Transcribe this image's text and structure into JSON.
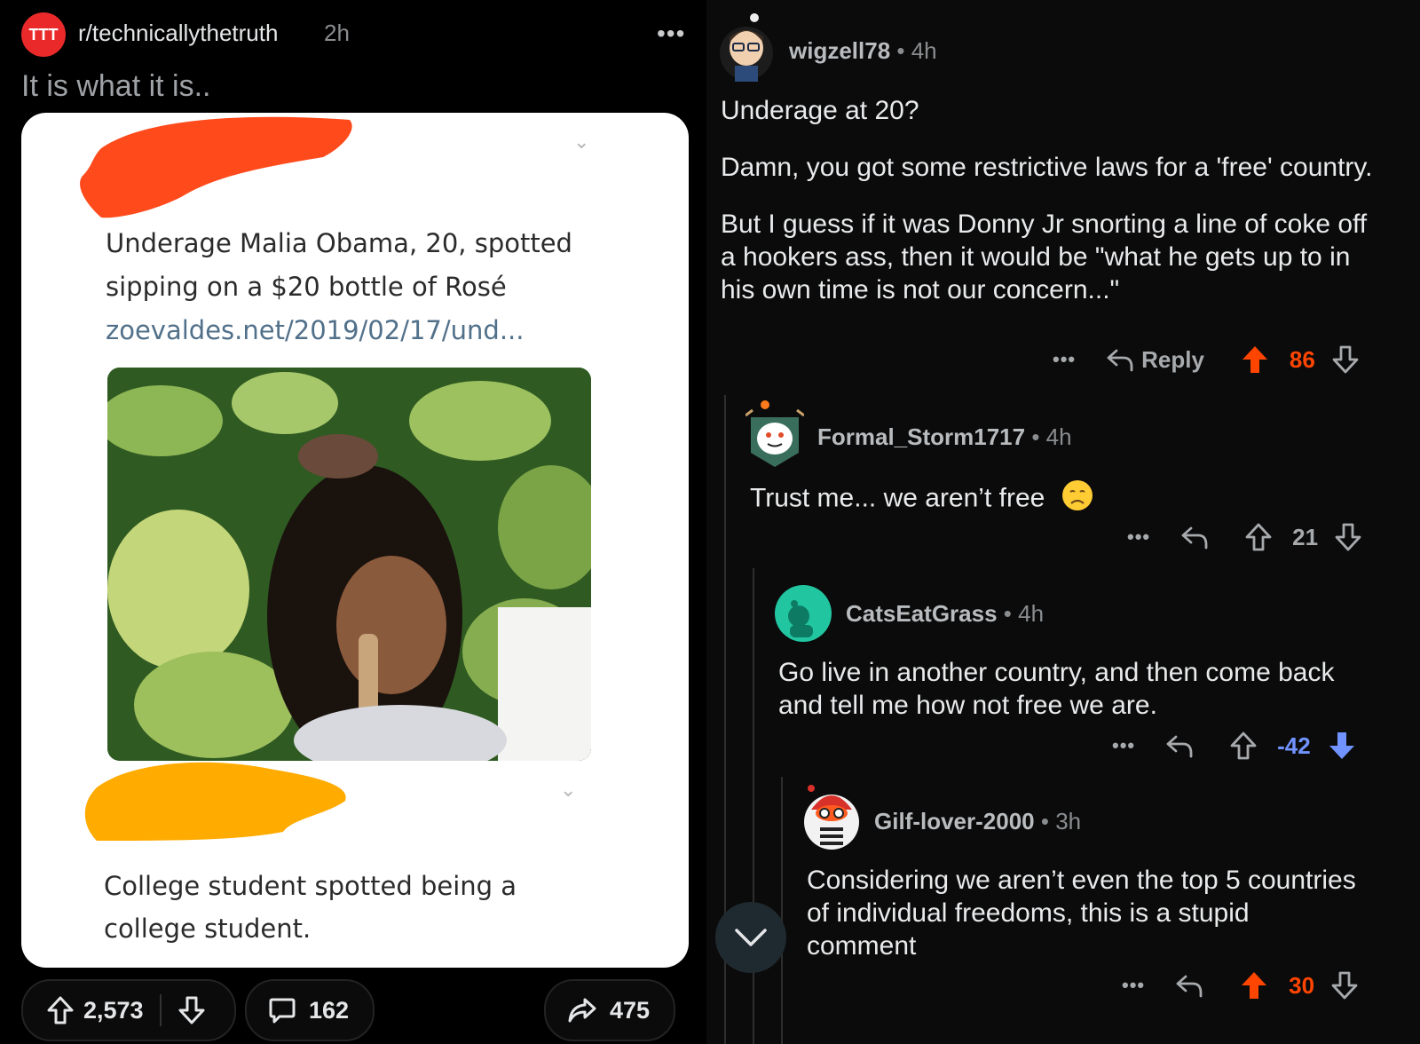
{
  "post": {
    "subreddit_badge": "TTT",
    "subreddit": "r/technicallythetruth",
    "age": "2h",
    "more": "•••",
    "title": "It is what it is..",
    "tweet1": {
      "line1": "Underage Malia Obama, 20, spotted",
      "line2": "sipping on a $20 bottle of Rosé",
      "link": "zoevaldes.net/2019/02/17/und..."
    },
    "tweet2": {
      "line1": "College student spotted being a",
      "line2": "college student."
    },
    "actions": {
      "upvotes": "2,573",
      "comments": "162",
      "shares": "475"
    }
  },
  "comments": [
    {
      "user": "wigzell78",
      "age": "4h",
      "paragraphs": [
        "Underage at 20?",
        "Damn, you got some restrictive laws for a 'free' country.",
        "But I guess if it was Donny Jr snorting a line of coke off a hookers ass, then it would be \"what he gets up to in his own time is not our concern...\""
      ],
      "reply_label": "Reply",
      "score": "86"
    },
    {
      "user": "Formal_Storm1717",
      "age": "4h",
      "text": "Trust me... we aren’t free",
      "score": "21"
    },
    {
      "user": "CatsEatGrass",
      "age": "4h",
      "text": "Go live in another country, and then come back and tell me how not free we are.",
      "score": "-42"
    },
    {
      "user": "Gilf-lover-2000",
      "age": "3h",
      "text": "Considering we aren’t even the top 5 countries of individual freedoms, this is a stupid comment",
      "score": "30"
    }
  ],
  "colors": {
    "upvote_active": "#ff4500",
    "downvote_active": "#7193ff",
    "background": "#000000",
    "card": "#ffffff"
  },
  "icons": [
    "upvote-icon",
    "downvote-icon",
    "comment-icon",
    "share-icon",
    "reply-icon",
    "more-icon",
    "chevron-down-icon"
  ]
}
